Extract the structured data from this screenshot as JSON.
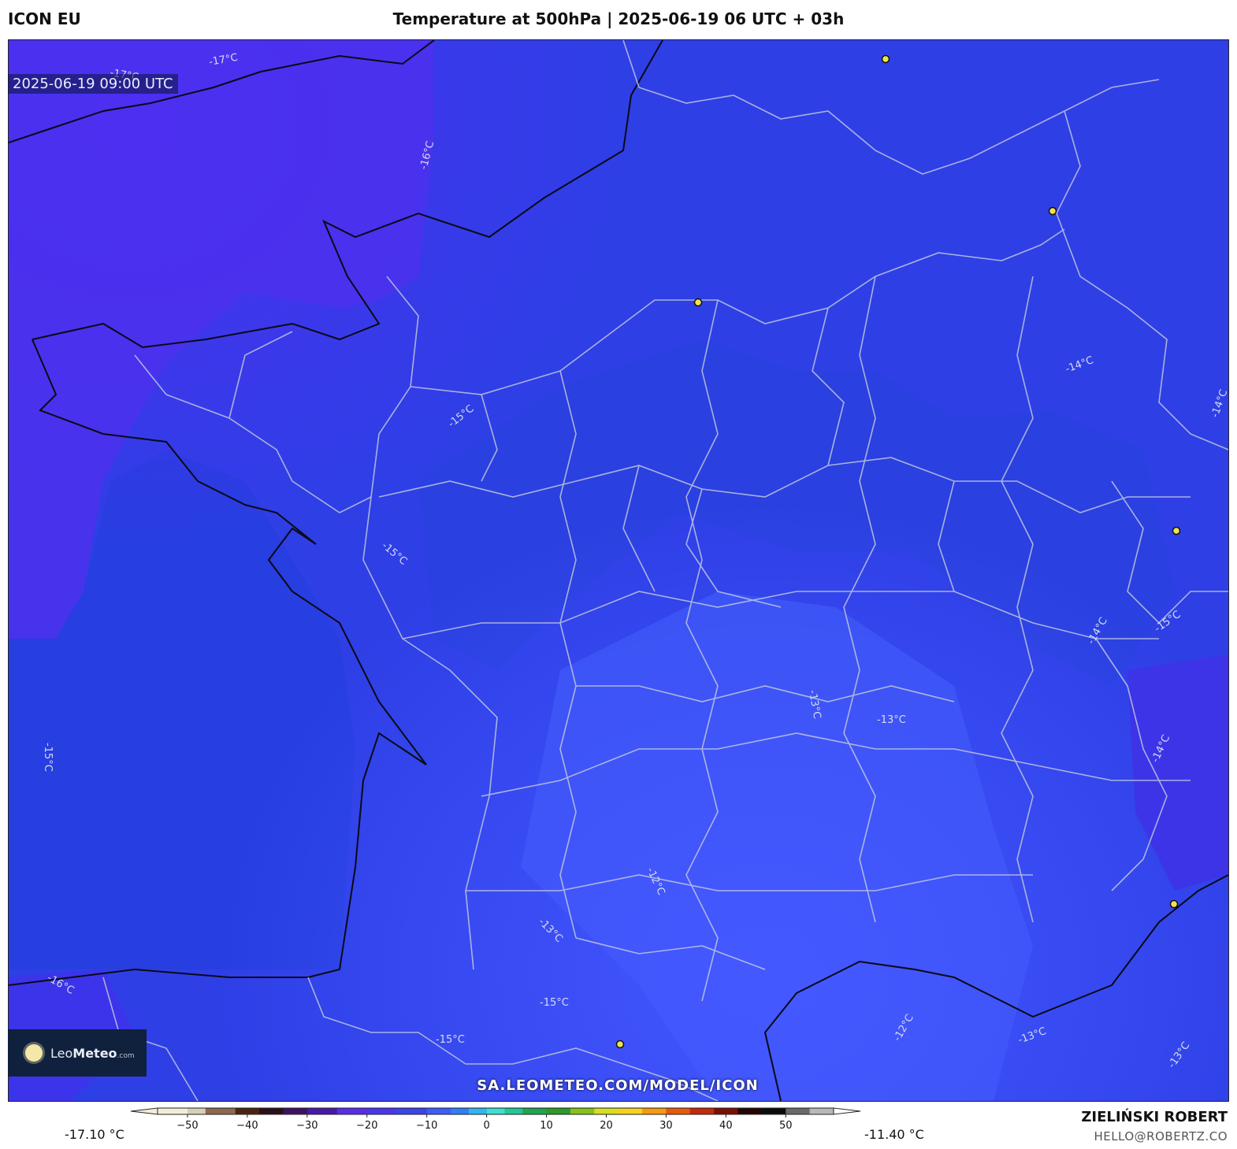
{
  "header": {
    "model": "ICON EU",
    "title": "Temperature at 500hPa | 2025-06-19 06 UTC + 03h"
  },
  "map": {
    "valid_time": "2025-06-19 09:00 UTC",
    "isotherm_labels": [
      {
        "text": "-17°C"
      },
      {
        "text": "-17°C"
      },
      {
        "text": "-16°C"
      },
      {
        "text": "-15°C"
      },
      {
        "text": "-15°C"
      },
      {
        "text": "-14°C"
      },
      {
        "text": "-14°C"
      },
      {
        "text": "-15°C"
      },
      {
        "text": "-14°C"
      },
      {
        "text": "-13°C"
      },
      {
        "text": "-13°C"
      },
      {
        "text": "-12°C"
      },
      {
        "text": "-13°C"
      },
      {
        "text": "-14°C"
      },
      {
        "text": "-15°C"
      },
      {
        "text": "-12°C"
      },
      {
        "text": "-13°C"
      },
      {
        "text": "-13°C"
      },
      {
        "text": "-16°C"
      },
      {
        "text": "-15°C"
      },
      {
        "text": "-15°C"
      }
    ],
    "colors": {
      "cold": "#4a2cf0",
      "mid": "#2f45e6",
      "warm": "#3d5cff",
      "border": "#bfc6e0",
      "coast": "#0a0a14",
      "city": "#f2e24a"
    }
  },
  "logo": {
    "brand_light": "Leo",
    "brand_bold": "Meteo",
    "suffix": ".com"
  },
  "source_url": "SA.LEOMETEO.COM/MODEL/ICON",
  "colorbar": {
    "min_label": "-17.10 °C",
    "max_label": "-11.40 °C",
    "ticks": [
      "−50",
      "−40",
      "−30",
      "−20",
      "−10",
      "0",
      "10",
      "20",
      "30",
      "40",
      "50"
    ],
    "range": [
      -55,
      58
    ]
  },
  "credit": {
    "name": "ZIELIŃSKI ROBERT",
    "email": "HELLO@ROBERTZ.CO"
  }
}
